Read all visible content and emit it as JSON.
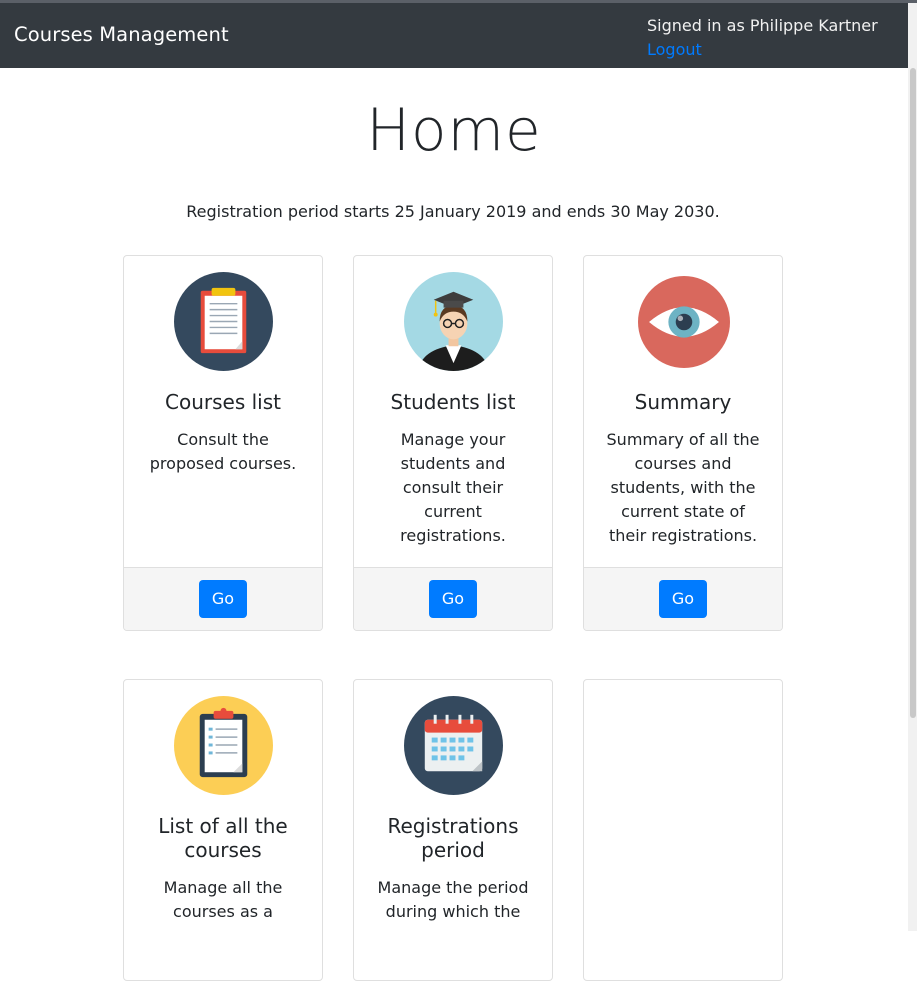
{
  "navbar": {
    "brand": "Courses Management",
    "signed_in": "Signed in as Philippe Kartner",
    "logout": "Logout"
  },
  "main": {
    "title": "Home",
    "registration_period": "Registration period starts 25 January 2019 and ends 30 May 2030."
  },
  "cards": [
    {
      "title": "Courses list",
      "text": "Consult the proposed courses.",
      "button": "Go",
      "icon": "clipboard-icon"
    },
    {
      "title": "Students list",
      "text": "Manage your students and consult their current registrations.",
      "button": "Go",
      "icon": "graduate-icon"
    },
    {
      "title": "Summary",
      "text": "Summary of all the courses and students, with the current state of their registrations.",
      "button": "Go",
      "icon": "eye-icon"
    },
    {
      "title": "List of all the courses",
      "text": "Manage all the courses as a",
      "icon": "checklist-icon"
    },
    {
      "title": "Registrations period",
      "text": "Manage the period during which the",
      "icon": "calendar-icon"
    }
  ],
  "colors": {
    "navbar_bg": "#343a40",
    "primary": "#007bff",
    "link": "#007bff"
  }
}
